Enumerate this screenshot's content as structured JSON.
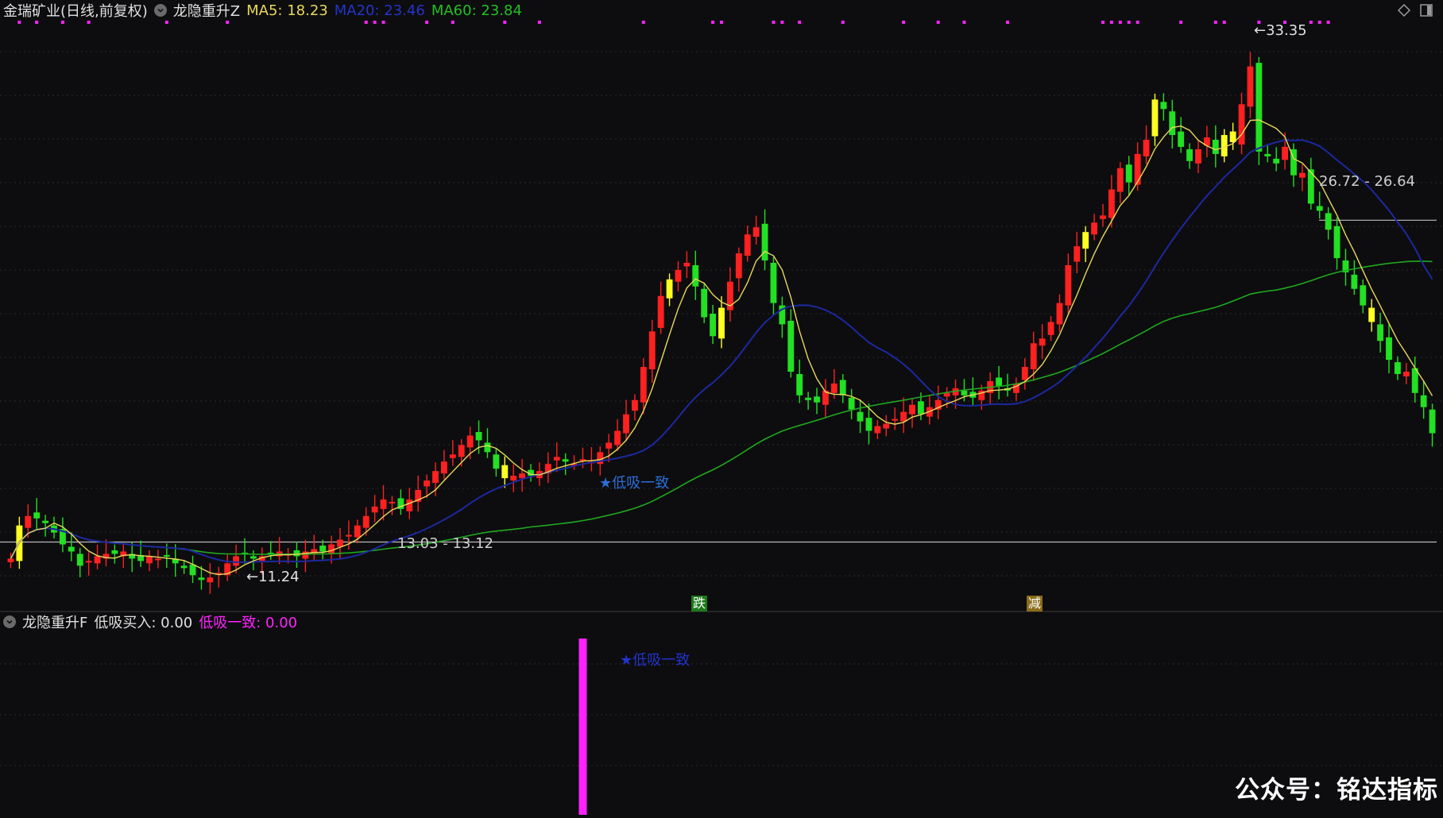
{
  "header": {
    "stock_title": "金瑞矿业(日线,前复权)",
    "indicator_name": "龙隐重升Z",
    "ma5_text": "MA5: 18.23",
    "ma20_text": "MA20: 23.46",
    "ma60_text": "MA60: 23.84"
  },
  "sub_header": {
    "indicator_name": "龙隐重升F",
    "buy_text": "低吸买入: 0.00",
    "consensus_text": "低吸一致: 0.00"
  },
  "annotations": {
    "high": "33.35",
    "low": "11.24",
    "range_mid": "13.03 - 13.12",
    "range_right": "26.72 - 26.64",
    "signal_main": "★低吸一致",
    "signal_sub": "★低吸一致",
    "badge_fall": "跌",
    "badge_reduce": "减",
    "watermark": "公众号：铭达指标"
  },
  "colors": {
    "background": "#0d0d0f",
    "up_candle": "#ff2020",
    "down_candle": "#22e022",
    "signal_candle": "#ffff22",
    "ma5": "#e8d85a",
    "ma20": "#1c28a0",
    "ma60": "#1fa81f",
    "magenta": "#ff22ff",
    "signal_text": "#2b6fd8"
  },
  "icons": [
    "collapse-circle-icon",
    "diamond-icon",
    "window-icon"
  ],
  "chart_data": [
    {
      "type": "candlestick",
      "ylim": [
        10.5,
        35
      ],
      "close": [
        12.4,
        13.8,
        14.2,
        14.1,
        13.9,
        13.5,
        13.0,
        12.7,
        12.1,
        12.3,
        12.5,
        12.6,
        12.6,
        12.7,
        12.4,
        12.3,
        12.5,
        12.4,
        12.5,
        12.2,
        12.0,
        11.7,
        11.5,
        11.6,
        11.8,
        12.2,
        12.5,
        12.6,
        12.4,
        12.5,
        12.6,
        12.7,
        12.6,
        12.5,
        12.7,
        12.8,
        12.7,
        13.0,
        13.2,
        13.4,
        13.8,
        14.2,
        14.6,
        14.9,
        14.8,
        14.5,
        14.9,
        15.3,
        15.7,
        16.1,
        16.5,
        16.8,
        17.2,
        17.6,
        17.4,
        16.9,
        16.2,
        15.8,
        15.9,
        16.0,
        15.9,
        16.1,
        16.4,
        16.7,
        16.5,
        16.4,
        16.6,
        16.5,
        16.9,
        17.3,
        17.8,
        18.5,
        19.1,
        20.5,
        22.0,
        23.5,
        24.2,
        24.6,
        24.9,
        23.9,
        22.6,
        21.8,
        23.0,
        24.1,
        25.3,
        26.1,
        26.4,
        25.0,
        23.2,
        22.3,
        20.3,
        19.3,
        19.1,
        19.0,
        19.5,
        19.8,
        19.3,
        18.7,
        18.2,
        17.8,
        18.0,
        18.1,
        18.3,
        18.6,
        18.9,
        18.5,
        18.8,
        19.1,
        19.4,
        19.6,
        19.3,
        19.2,
        19.5,
        19.9,
        19.7,
        19.5,
        19.8,
        20.5,
        21.5,
        21.7,
        22.4,
        23.2,
        24.8,
        25.6,
        26.2,
        26.6,
        26.9,
        28.0,
        28.9,
        28.3,
        29.5,
        30.1,
        31.8,
        31.4,
        30.3,
        29.8,
        29.2,
        29.7,
        30.2,
        29.5,
        30.3,
        30.0,
        31.6,
        33.2,
        29.6,
        29.4,
        29.1,
        29.8,
        28.6,
        28.7,
        27.4,
        27.1,
        26.3,
        25.1,
        24.5,
        23.8,
        23.1,
        22.4,
        21.6,
        20.8,
        20.2,
        20.3,
        19.4,
        18.8,
        17.7
      ]
    },
    {
      "type": "bar",
      "series": [
        {
          "name": "低吸一致",
          "values_at_candle_index": {
            "66": 1.0
          }
        }
      ]
    }
  ]
}
